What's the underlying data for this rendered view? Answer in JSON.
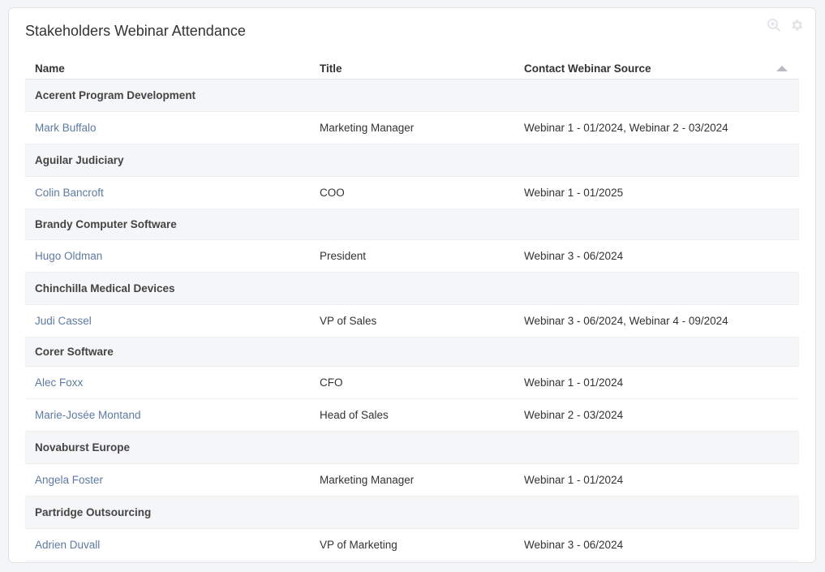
{
  "widget": {
    "title": "Stakeholders Webinar Attendance",
    "icons": [
      "search-icon",
      "gear-icon"
    ]
  },
  "table": {
    "columns": [
      "Name",
      "Title",
      "Contact Webinar Source"
    ],
    "groups": [
      {
        "company": "Acerent Program Development",
        "contacts": [
          {
            "name": "Mark Buffalo",
            "title": "Marketing Manager",
            "source": "Webinar 1 - 01/2024, Webinar 2 - 03/2024"
          }
        ]
      },
      {
        "company": "Aguilar Judiciary",
        "contacts": [
          {
            "name": "Colin Bancroft",
            "title": "COO",
            "source": "Webinar 1 - 01/2025"
          }
        ]
      },
      {
        "company": "Brandy Computer Software",
        "contacts": [
          {
            "name": "Hugo Oldman",
            "title": "President",
            "source": "Webinar 3 - 06/2024"
          }
        ]
      },
      {
        "company": "Chinchilla Medical Devices",
        "contacts": [
          {
            "name": "Judi Cassel",
            "title": "VP of Sales",
            "source": "Webinar 3 - 06/2024, Webinar 4 - 09/2024"
          }
        ]
      },
      {
        "company": "Corer Software",
        "contacts": [
          {
            "name": "Alec Foxx",
            "title": "CFO",
            "source": "Webinar 1 - 01/2024"
          },
          {
            "name": "Marie-Josée Montand",
            "title": "Head of Sales",
            "source": "Webinar 2 - 03/2024"
          }
        ]
      },
      {
        "company": "Novaburst Europe",
        "contacts": [
          {
            "name": "Angela Foster",
            "title": "Marketing Manager",
            "source": "Webinar 1 - 01/2024"
          }
        ]
      },
      {
        "company": "Partridge Outsourcing",
        "contacts": [
          {
            "name": "Adrien Duvall",
            "title": "VP of Marketing",
            "source": "Webinar 3 - 06/2024"
          }
        ]
      }
    ]
  }
}
